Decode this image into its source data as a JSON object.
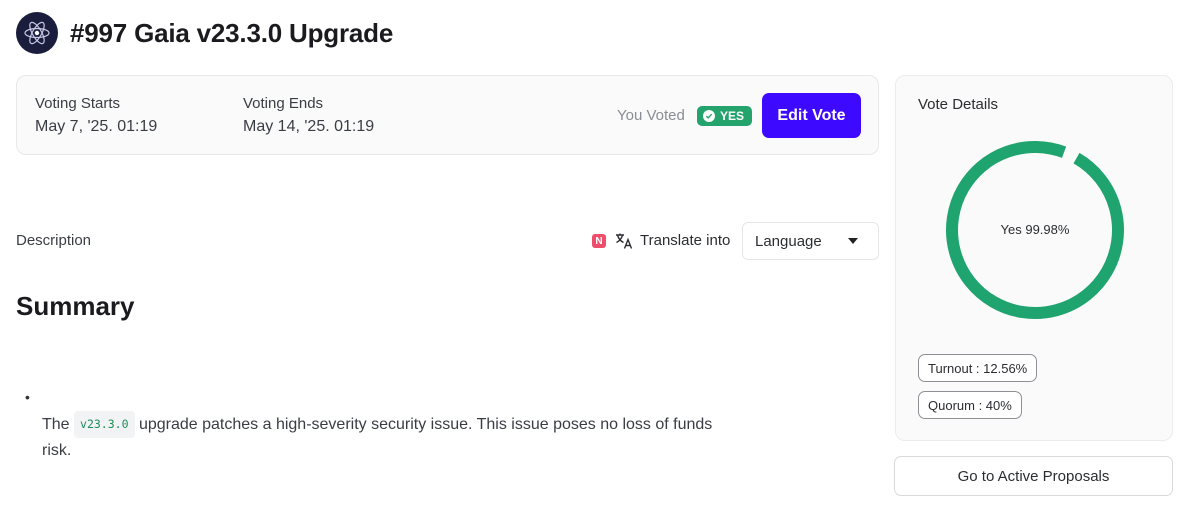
{
  "header": {
    "title": "#997 Gaia v23.3.0 Upgrade",
    "logo_icon": "cosmos-atom-icon"
  },
  "voting": {
    "start_label": "Voting Starts",
    "start_value": "May 7, '25. 01:19",
    "end_label": "Voting Ends",
    "end_value": "May 14, '25. 01:19",
    "you_voted_label": "You Voted",
    "vote_badge": "YES",
    "edit_button": "Edit Vote"
  },
  "description": {
    "label": "Description",
    "n_badge": "N",
    "translate_label": "Translate into",
    "language_select": "Language"
  },
  "content": {
    "heading": "Summary",
    "bullet": "•",
    "para_prefix": "The",
    "code": "v23.3.0",
    "para_suffix": "upgrade patches a high-severity security issue. This issue poses no loss of funds risk."
  },
  "vote_details": {
    "title": "Vote Details",
    "center_label": "Yes 99.98%",
    "yes_fraction": 0.9998,
    "turnout": "Turnout : 12.56%",
    "quorum": "Quorum : 40%"
  },
  "colors": {
    "accent": "#3d0aff",
    "yes_green": "#24a36d",
    "donut_green": "#1fa36f"
  },
  "footer": {
    "active_proposals_button": "Go to Active Proposals"
  }
}
